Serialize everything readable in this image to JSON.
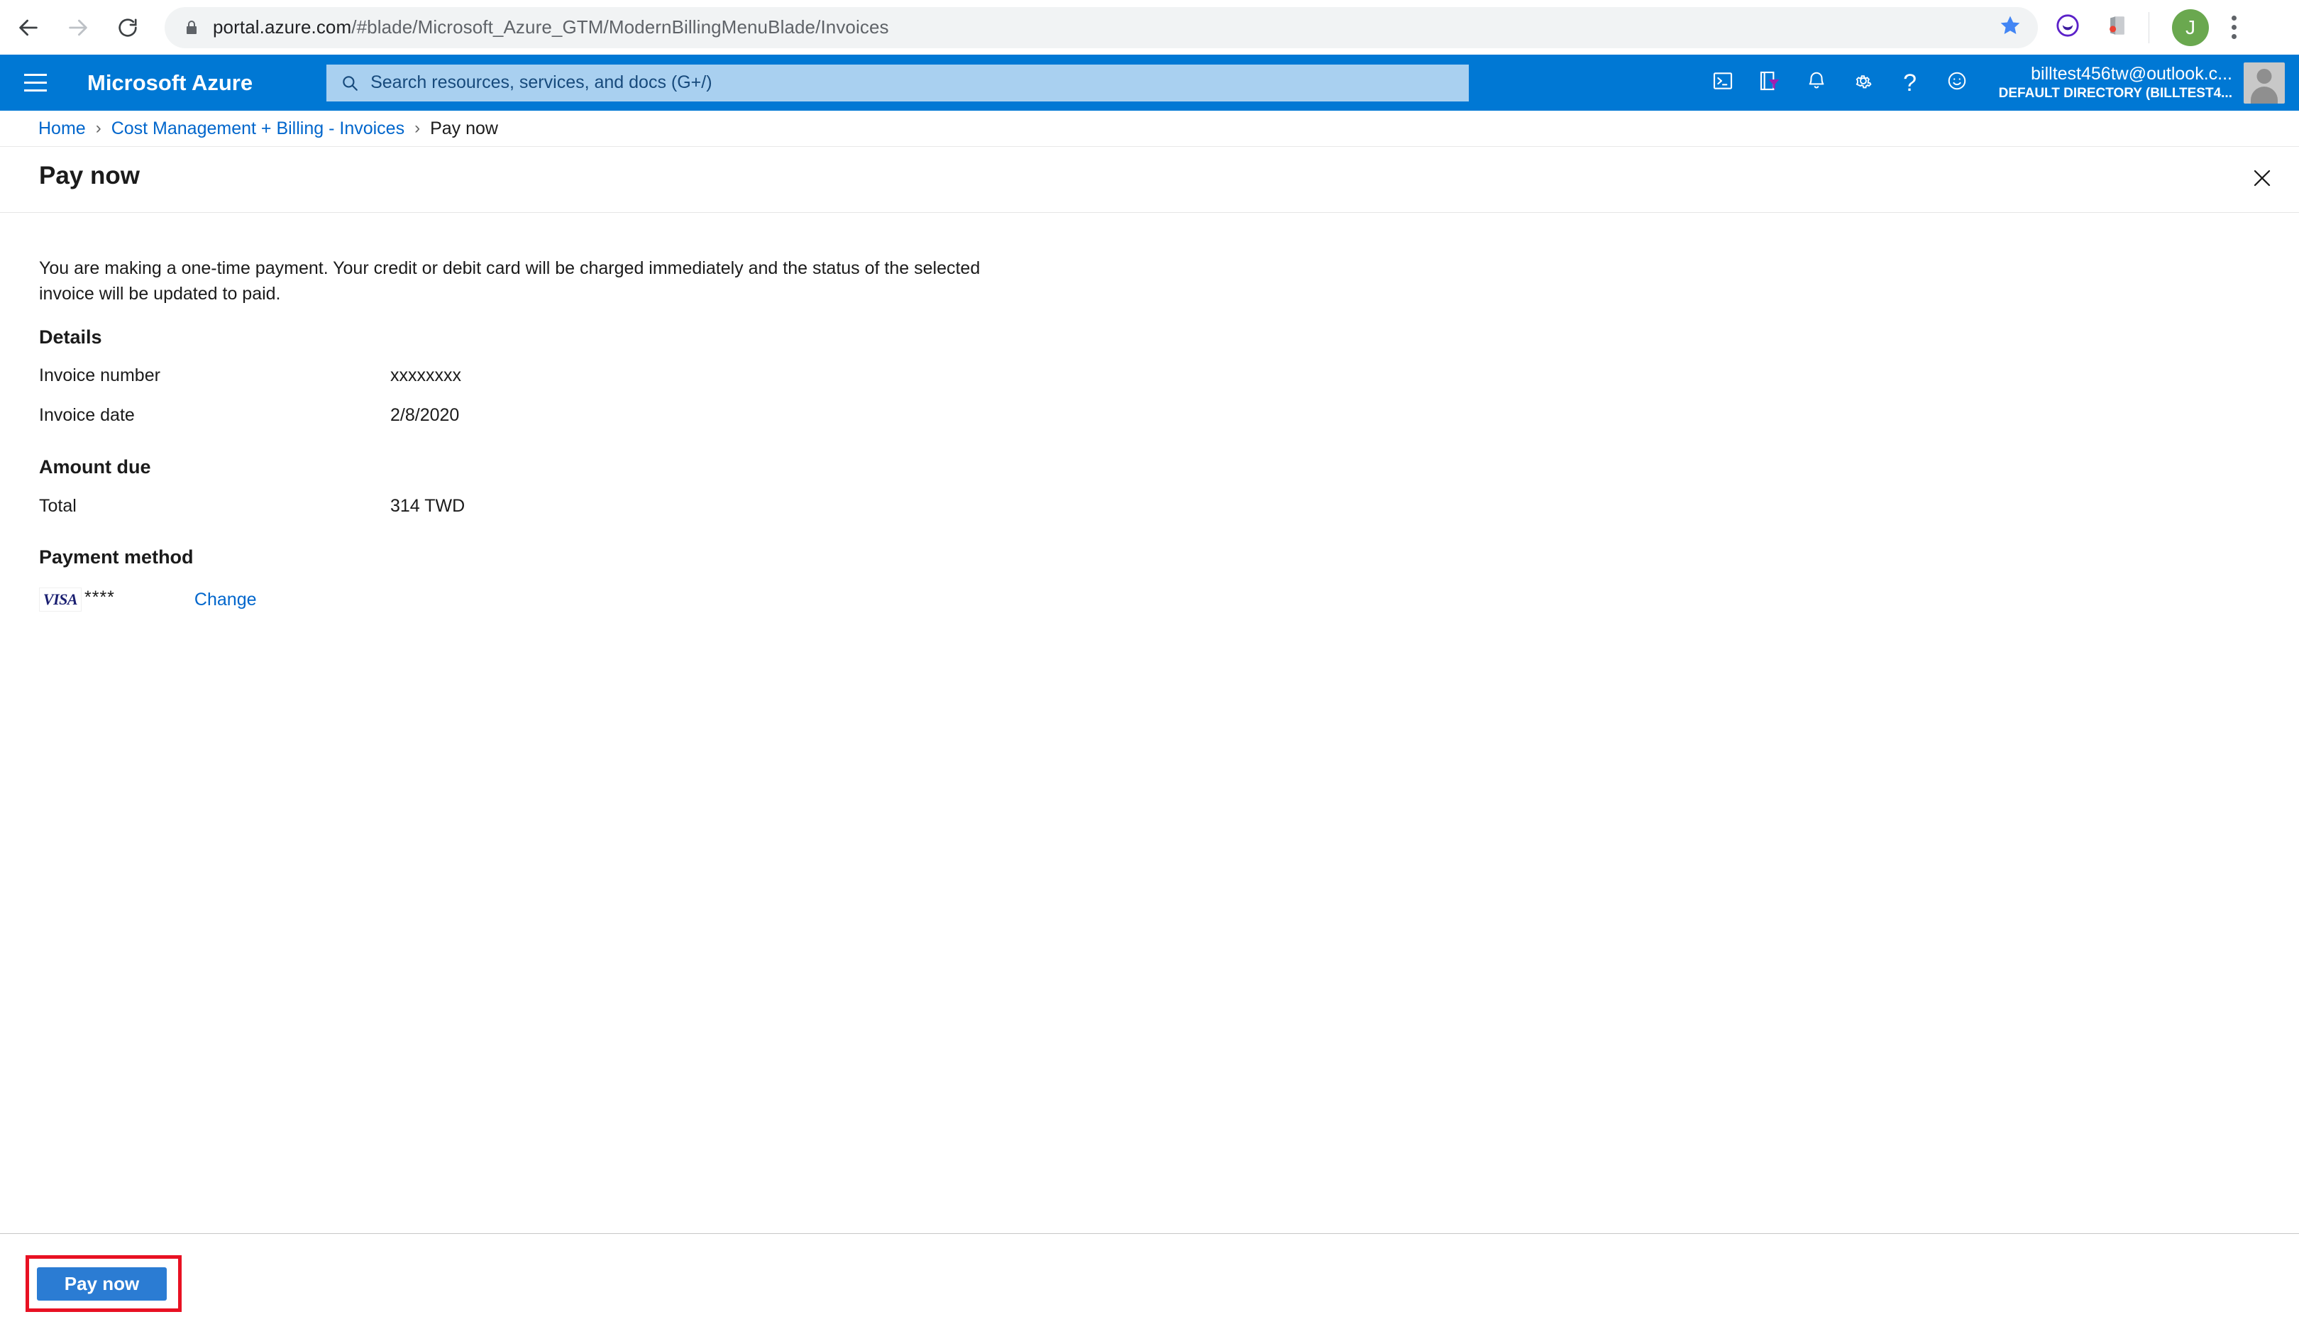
{
  "browser": {
    "back_icon": "back-arrow-icon",
    "forward_icon": "forward-arrow-icon",
    "reload_icon": "reload-icon",
    "lock_icon": "lock-icon",
    "url_host": "portal.azure.com",
    "url_path": "/#blade/Microsoft_Azure_GTM/ModernBillingMenuBlade/Invoices",
    "star_icon": "bookmark-star-icon",
    "extension_icons": [
      "purple-circle-extension-icon",
      "collections-extension-icon"
    ],
    "profile_initial": "J",
    "menu_icon": "three-dot-menu-icon"
  },
  "azure_header": {
    "menu_icon": "hamburger-menu-icon",
    "brand": "Microsoft Azure",
    "search": {
      "icon": "search-icon",
      "placeholder": "Search resources, services, and docs (G+/)",
      "value": ""
    },
    "icons": [
      "cloud-shell-icon",
      "directory-filter-icon",
      "notifications-bell-icon",
      "settings-gear-icon",
      "help-question-icon",
      "feedback-smiley-icon"
    ],
    "account": {
      "email": "billtest456tw@outlook.c...",
      "directory": "DEFAULT DIRECTORY (BILLTEST4...",
      "avatar": "user-avatar-icon"
    }
  },
  "breadcrumb": {
    "items": [
      {
        "label": "Home",
        "is_link": true
      },
      {
        "label": "Cost Management + Billing - Invoices",
        "is_link": true
      },
      {
        "label": "Pay now",
        "is_link": false
      }
    ],
    "separator": "›"
  },
  "blade": {
    "title": "Pay now",
    "close_icon": "close-x-icon",
    "intro": "You are making a one-time payment. Your credit or debit card will be charged immediately and the status of the selected invoice will be updated to paid.",
    "sections": {
      "details": {
        "heading": "Details",
        "rows": [
          {
            "label": "Invoice number",
            "value": "xxxxxxxx"
          },
          {
            "label": "Invoice date",
            "value": "2/8/2020"
          }
        ]
      },
      "amount_due": {
        "heading": "Amount due",
        "rows": [
          {
            "label": "Total",
            "value": "314 TWD"
          }
        ]
      },
      "payment_method": {
        "heading": "Payment method",
        "card_brand": "VISA",
        "card_mask": "****",
        "change_label": "Change"
      }
    }
  },
  "action_bar": {
    "pay_now_label": "Pay now",
    "highlight_color": "#e81123",
    "button_color": "#2b7cd3"
  },
  "colors": {
    "azure_blue": "#0078d4",
    "link_blue": "#0066cc",
    "search_bg": "#a9d0f0",
    "visa_blue": "#1a1f71"
  }
}
